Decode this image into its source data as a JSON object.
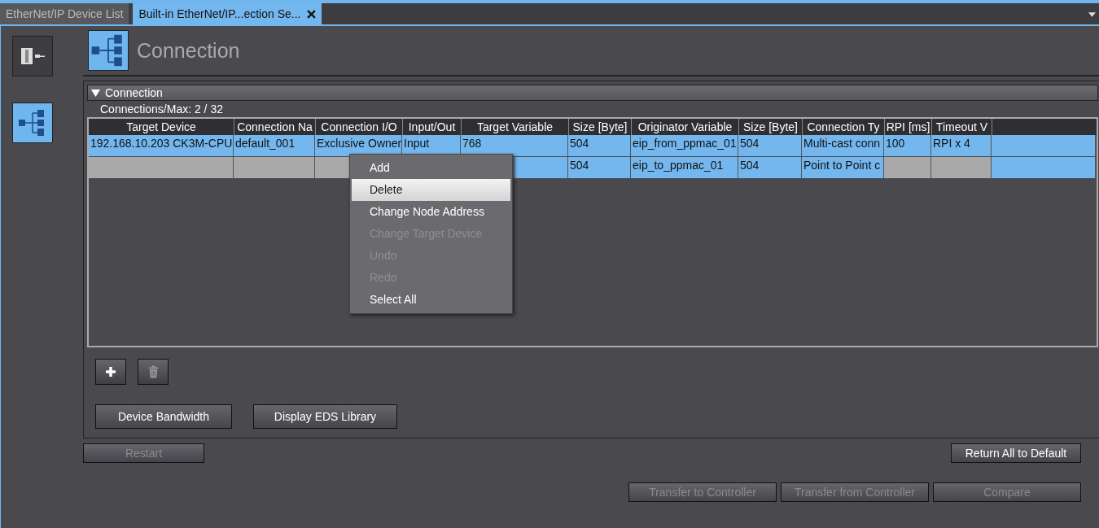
{
  "tabs": [
    {
      "label": "EtherNet/IP Device List",
      "selected": false,
      "closable": false
    },
    {
      "label": "Built-in EtherNet/IP...ection Se...",
      "selected": true,
      "closable": true
    }
  ],
  "sidebar": {
    "items": [
      {
        "kind": "device",
        "selected": false
      },
      {
        "kind": "connection",
        "selected": true
      }
    ]
  },
  "header": {
    "title": "Connection"
  },
  "section": {
    "title": "Connection",
    "expanded": true,
    "count_label": "Connections/Max: 2 / 32"
  },
  "table": {
    "columns": [
      "Target Device",
      "Connection Na",
      "Connection I/O",
      "Input/Out",
      "Target Variable",
      "Size [Byte]",
      "Originator Variable",
      "Size [Byte]",
      "Connection Ty",
      "RPI [ms]",
      "Timeout V",
      ""
    ],
    "rows": [
      {
        "cells": [
          {
            "text": "192.168.10.203 CK3M-CPU",
            "disabled": false
          },
          {
            "text": "default_001",
            "disabled": false
          },
          {
            "text": "Exclusive Owner",
            "disabled": false
          },
          {
            "text": "Input",
            "disabled": false
          },
          {
            "text": "768",
            "disabled": false
          },
          {
            "text": "504",
            "disabled": false
          },
          {
            "text": "eip_from_ppmac_01",
            "disabled": false
          },
          {
            "text": "504",
            "disabled": false
          },
          {
            "text": "Multi-cast conn",
            "disabled": false
          },
          {
            "text": "100",
            "disabled": false
          },
          {
            "text": "RPI x 4",
            "disabled": false
          },
          {
            "disabled": false
          }
        ]
      },
      {
        "cells": [
          {
            "disabled": true
          },
          {
            "disabled": true
          },
          {
            "disabled": true
          },
          {},
          {
            "disabled": false
          },
          {
            "text": "504",
            "disabled": false
          },
          {
            "text": "eip_to_ppmac_01",
            "disabled": false
          },
          {
            "text": "504",
            "disabled": false
          },
          {
            "text": "Point to Point c",
            "disabled": false
          },
          {
            "disabled": true
          },
          {
            "disabled": true
          },
          {
            "disabled": false
          }
        ]
      }
    ]
  },
  "context_menu": {
    "items": [
      {
        "label": "Add",
        "disabled": false,
        "selected": false
      },
      {
        "label": "Delete",
        "disabled": false,
        "selected": true
      },
      {
        "label": "Change Node Address",
        "disabled": false,
        "selected": false
      },
      {
        "label": "Change Target Device",
        "disabled": true,
        "selected": false
      },
      {
        "label": "Undo",
        "disabled": true,
        "selected": false
      },
      {
        "label": "Redo",
        "disabled": true,
        "selected": false
      },
      {
        "label": "Select All",
        "disabled": false,
        "selected": false
      }
    ]
  },
  "tool_buttons": [
    {
      "kind": "add",
      "disabled": false
    },
    {
      "kind": "delete",
      "disabled": true
    }
  ],
  "panel_buttons": [
    {
      "label": "Device Bandwidth",
      "disabled": false
    },
    {
      "label": "Display EDS Library",
      "disabled": false
    }
  ],
  "restart_button": {
    "label": "Restart",
    "disabled": true
  },
  "default_button": {
    "label": "Return All to Default",
    "disabled": false
  },
  "footer_buttons": [
    {
      "label": "Transfer to Controller",
      "disabled": true
    },
    {
      "label": "Transfer from Controller",
      "disabled": true
    },
    {
      "label": "Compare",
      "disabled": true
    }
  ]
}
